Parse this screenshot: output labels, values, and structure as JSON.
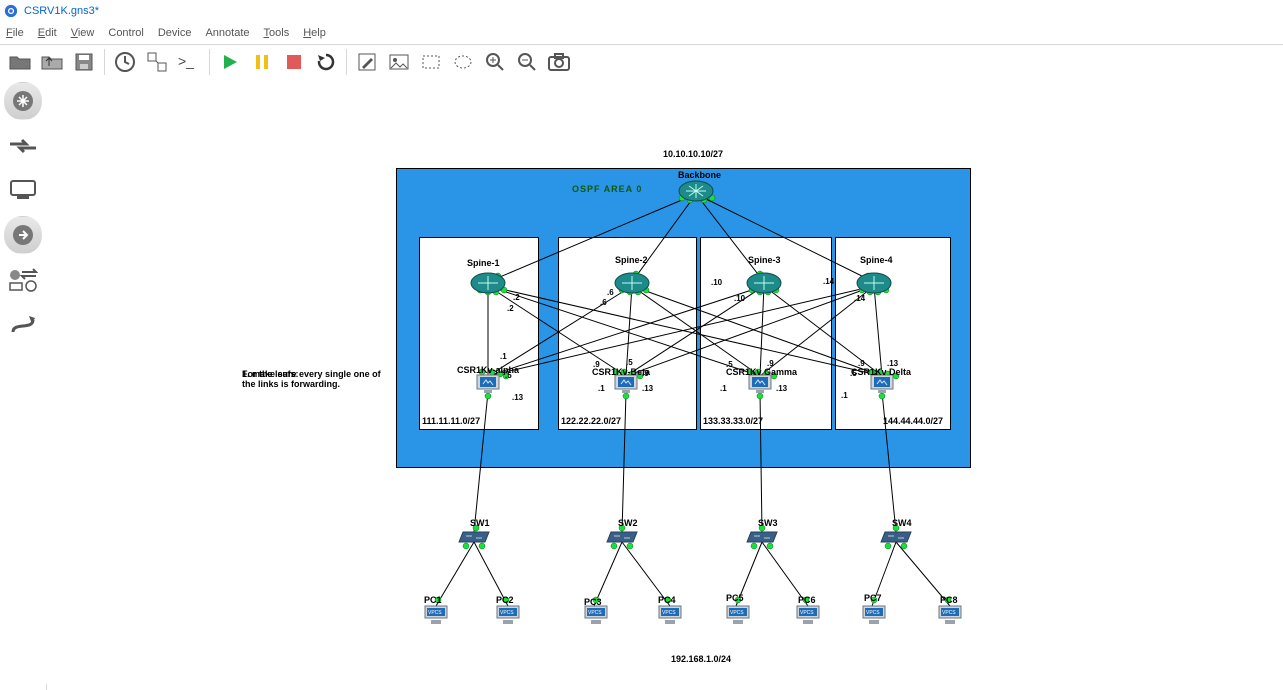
{
  "title": "CSRV1K.gns3*",
  "menu": {
    "file": "File",
    "edit": "Edit",
    "view": "View",
    "control": "Control",
    "device": "Device",
    "annotate": "Annotate",
    "tools": "Tools",
    "help": "Help"
  },
  "note": {
    "line1": "For the leafs:",
    "line2": "1. make sure every single one of the links is forwarding."
  },
  "subnets": {
    "top": "10.10.10.10/27",
    "pod1": "111.11.11.0/27",
    "pod2": "122.22.22.0/27",
    "pod3": "133.33.33.0/27",
    "pod4": "144.44.44.0/27",
    "bottom": "192.168.1.0/24"
  },
  "area_label": "OSPF AREA 0",
  "nodes": {
    "backbone": "Backbone",
    "spine1": "Spine-1",
    "spine2": "Spine-2",
    "spine3": "Spine-3",
    "spine4": "Spine-4",
    "leaf1": "CSR1Kv-alpha",
    "leaf2": "CSR1Kv-Beta",
    "leaf3": "CSR1Kv Gamma",
    "leaf4": "CSR1Kv Delta",
    "sw1": "SW1",
    "sw2": "SW2",
    "sw3": "SW3",
    "sw4": "SW4",
    "pc1": "PC1",
    "pc2": "PC2",
    "pc3": "PC3",
    "pc4": "PC4",
    "pc5": "PC5",
    "pc6": "PC6",
    "pc7": "PC7",
    "pc8": "PC8"
  },
  "vpcs": "VPCS",
  "iface": {
    "s1_a": ".2",
    "s1_b": ".2",
    "l1_a": ".1",
    "l1_d": ".5",
    "l1_b": ".13",
    "s2_a": ".6",
    "s2_b": ".6",
    "l2_a": ".1",
    "l2_b": ".5",
    "l2_c": ".9",
    "l2_d": ".13",
    "l2_e": ".9",
    "s3_a": ".10",
    "s3_b": ".10",
    "l3_a": ".1",
    "l3_b": ".5",
    "l3_c": ".9",
    "l3_d": ".13",
    "s4_a": ".14",
    "s4_b": ".14",
    "l4_a": ".1",
    "l4_b": ".5",
    "l4_c": ".9",
    "l4_d": ".13"
  }
}
